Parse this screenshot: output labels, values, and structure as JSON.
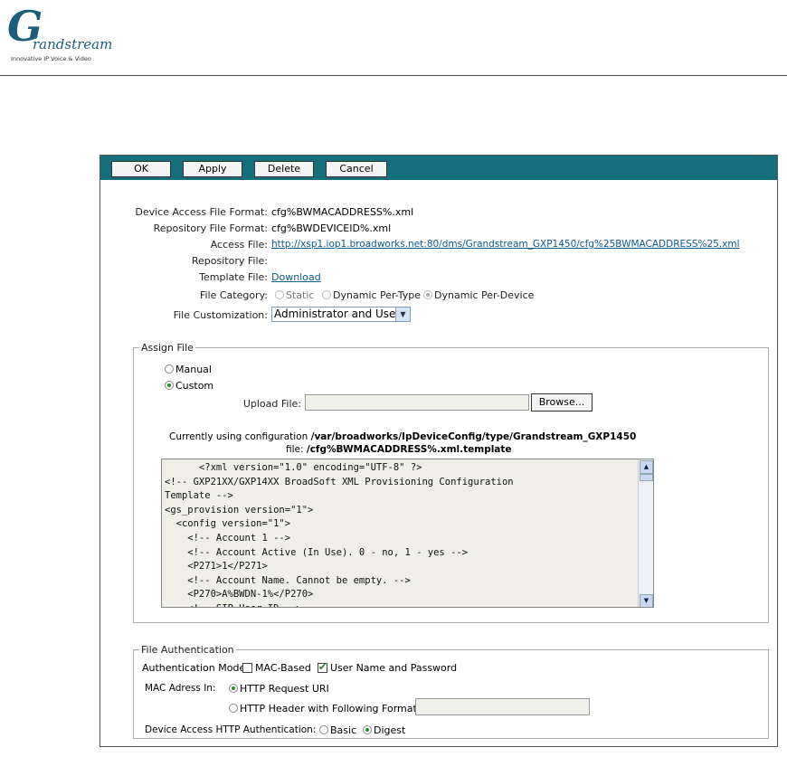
{
  "brand": {
    "logo_letter": "G",
    "logo_word": "randstream",
    "tagline": "Innovative IP Voice & Video",
    "color": "#1b5d7a"
  },
  "toolbar": {
    "color": "#156e7c",
    "ok_label": "OK",
    "apply_label": "Apply",
    "delete_label": "Delete",
    "cancel_label": "Cancel"
  },
  "info": {
    "device_access_label": "Device Access File Format:",
    "device_access_value": "cfg%BWMACADDRESS%.xml",
    "repository_format_label": "Repository File Format:",
    "repository_format_value": "cfg%BWDEVICEID%.xml",
    "access_file_label": "Access File:",
    "access_file_link": "http://xsp1.iop1.broadworks.net:80/dms/Grandstream_GXP1450/cfg%25BWMACADDRESS%25.xml",
    "repository_file_label": "Repository File:",
    "template_file_label": "Template File:",
    "template_file_link": "Download",
    "file_category_label": "File Category:",
    "category_options": [
      "Static",
      "Dynamic Per-Type",
      "Dynamic Per-Device"
    ],
    "file_customization_label": "File Customization:",
    "file_customization_value": "Administrator and User"
  },
  "assign": {
    "legend": "Assign File",
    "manual_label": "Manual",
    "custom_label": "Custom",
    "upload_label": "Upload File:",
    "browse_label": "Browse...",
    "using_prefix": "Currently using configuration",
    "using_path": "/var/broadworks/IpDeviceConfig/type/Grandstream_GXP1450",
    "file_prefix": "file:",
    "file_name": "/cfg%BWMACADDRESS%.xml.template",
    "xml_content": "      <?xml version=\"1.0\" encoding=\"UTF-8\" ?>\n<!-- GXP21XX/GXP14XX BroadSoft XML Provisioning Configuration\nTemplate -->\n<gs_provision version=\"1\">\n  <config version=\"1\">\n    <!-- Account 1 -->\n    <!-- Account Active (In Use). 0 - no, 1 - yes -->\n    <P271>1</P271>\n    <!-- Account Name. Cannot be empty. -->\n    <P270>A%BWDN-1%</P270>\n    <!-- SIP User ID -->"
  },
  "auth": {
    "legend": "File Authentication",
    "mode_label": "Authentication Mode:",
    "mac_based_label": "MAC-Based",
    "user_pass_label": "User Name and Password",
    "mac_in_label": "MAC Adress In:",
    "http_uri_label": "HTTP Request URI",
    "http_header_label": "HTTP Header with Following Format:",
    "device_http_label": "Device Access HTTP Authentication:",
    "basic_label": "Basic",
    "digest_label": "Digest"
  }
}
